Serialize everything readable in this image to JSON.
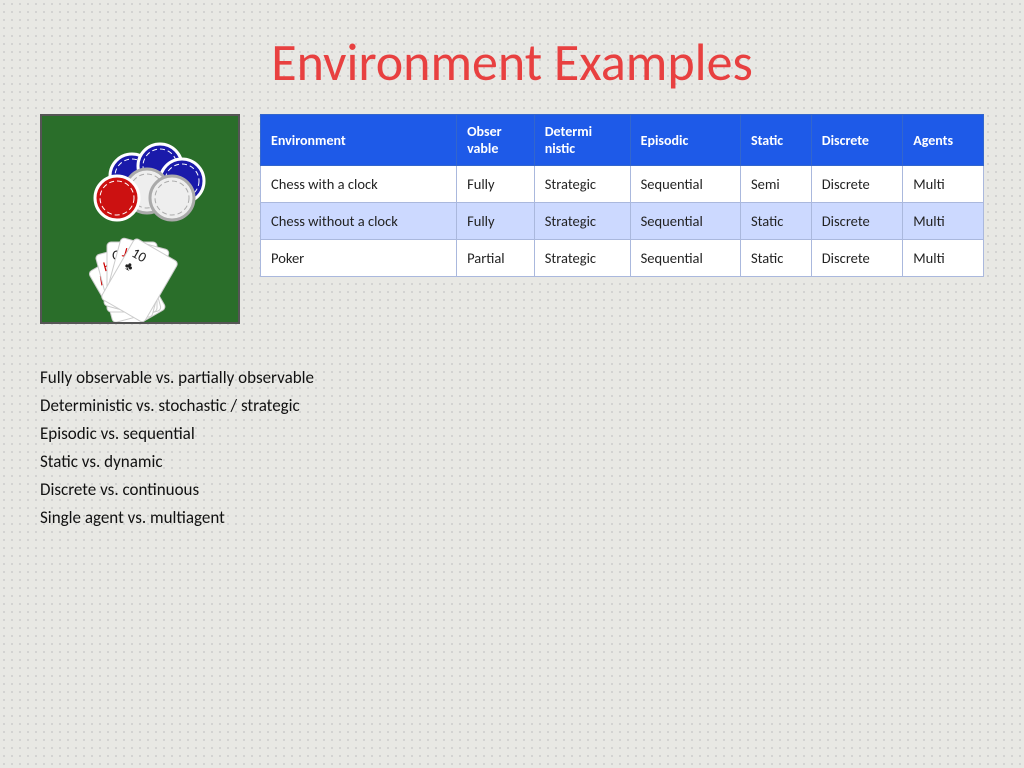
{
  "title": "Environment Examples",
  "table": {
    "headers": [
      "Environment",
      "Observable",
      "Deterministic",
      "Episodic",
      "Static",
      "Discrete",
      "Agents"
    ],
    "header_short": [
      "Environment",
      "Obser\nvable",
      "Determi\nnistic",
      "Episodic",
      "Static",
      "Discrete",
      "Agents"
    ],
    "rows": [
      [
        "Chess with a clock",
        "Fully",
        "Strategic",
        "Sequential",
        "Semi",
        "Discrete",
        "Multi"
      ],
      [
        "Chess without a clock",
        "Fully",
        "Strategic",
        "Sequential",
        "Static",
        "Discrete",
        "Multi"
      ],
      [
        "Poker",
        "Partial",
        "Strategic",
        "Sequential",
        "Static",
        "Discrete",
        "Multi"
      ]
    ]
  },
  "notes": [
    "Fully observable vs. partially observable",
    "Deterministic vs. stochastic / strategic",
    "Episodic vs. sequential",
    "Static vs. dynamic",
    "Discrete vs. continuous",
    "Single agent vs. multiagent"
  ]
}
